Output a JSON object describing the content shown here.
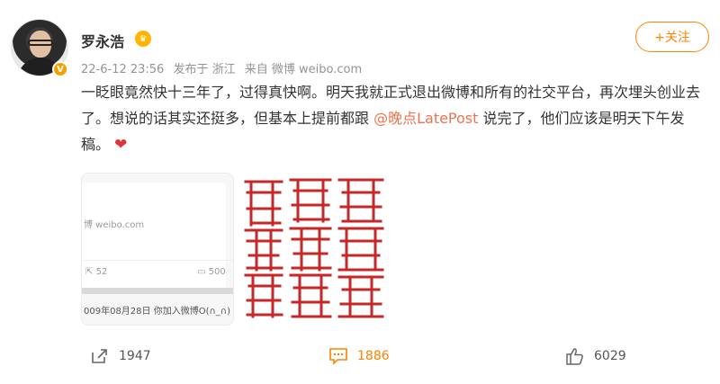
{
  "profile": {
    "name": "罗永浩",
    "verified_icon": "v-badge-icon",
    "member_icon": "crown-icon"
  },
  "post": {
    "time": "22-6-12 23:56",
    "location": "发布于 浙江",
    "source": "来自 微博 weibo.com",
    "text_1": "一眨眼竟然快十三年了，过得真快啊。明天我就正式退出微博和所有的社交平台，再次埋头创业去了。想说的话其实还挺多，但基本上提前都跟 ",
    "mention": "@晚点LatePost",
    "text_2": " 说完了，他们应该是明天下午发稿。",
    "emoji": "❤"
  },
  "follow_button": {
    "label": "+关注"
  },
  "images": {
    "thumb": {
      "url_text": "博 weibo.com",
      "repost_count": "52",
      "comment_count": "500",
      "caption": "009年08月28日 你加入微博O(∩_∩)"
    },
    "seal": {
      "icon": "red-seal-stamp-image"
    }
  },
  "actions": {
    "repost": "1947",
    "comment": "1886",
    "like": "6029"
  },
  "colors": {
    "accent": "#ff8200",
    "mention": "#eb7350",
    "heart": "#e0333b",
    "seal_red": "#c62828"
  }
}
